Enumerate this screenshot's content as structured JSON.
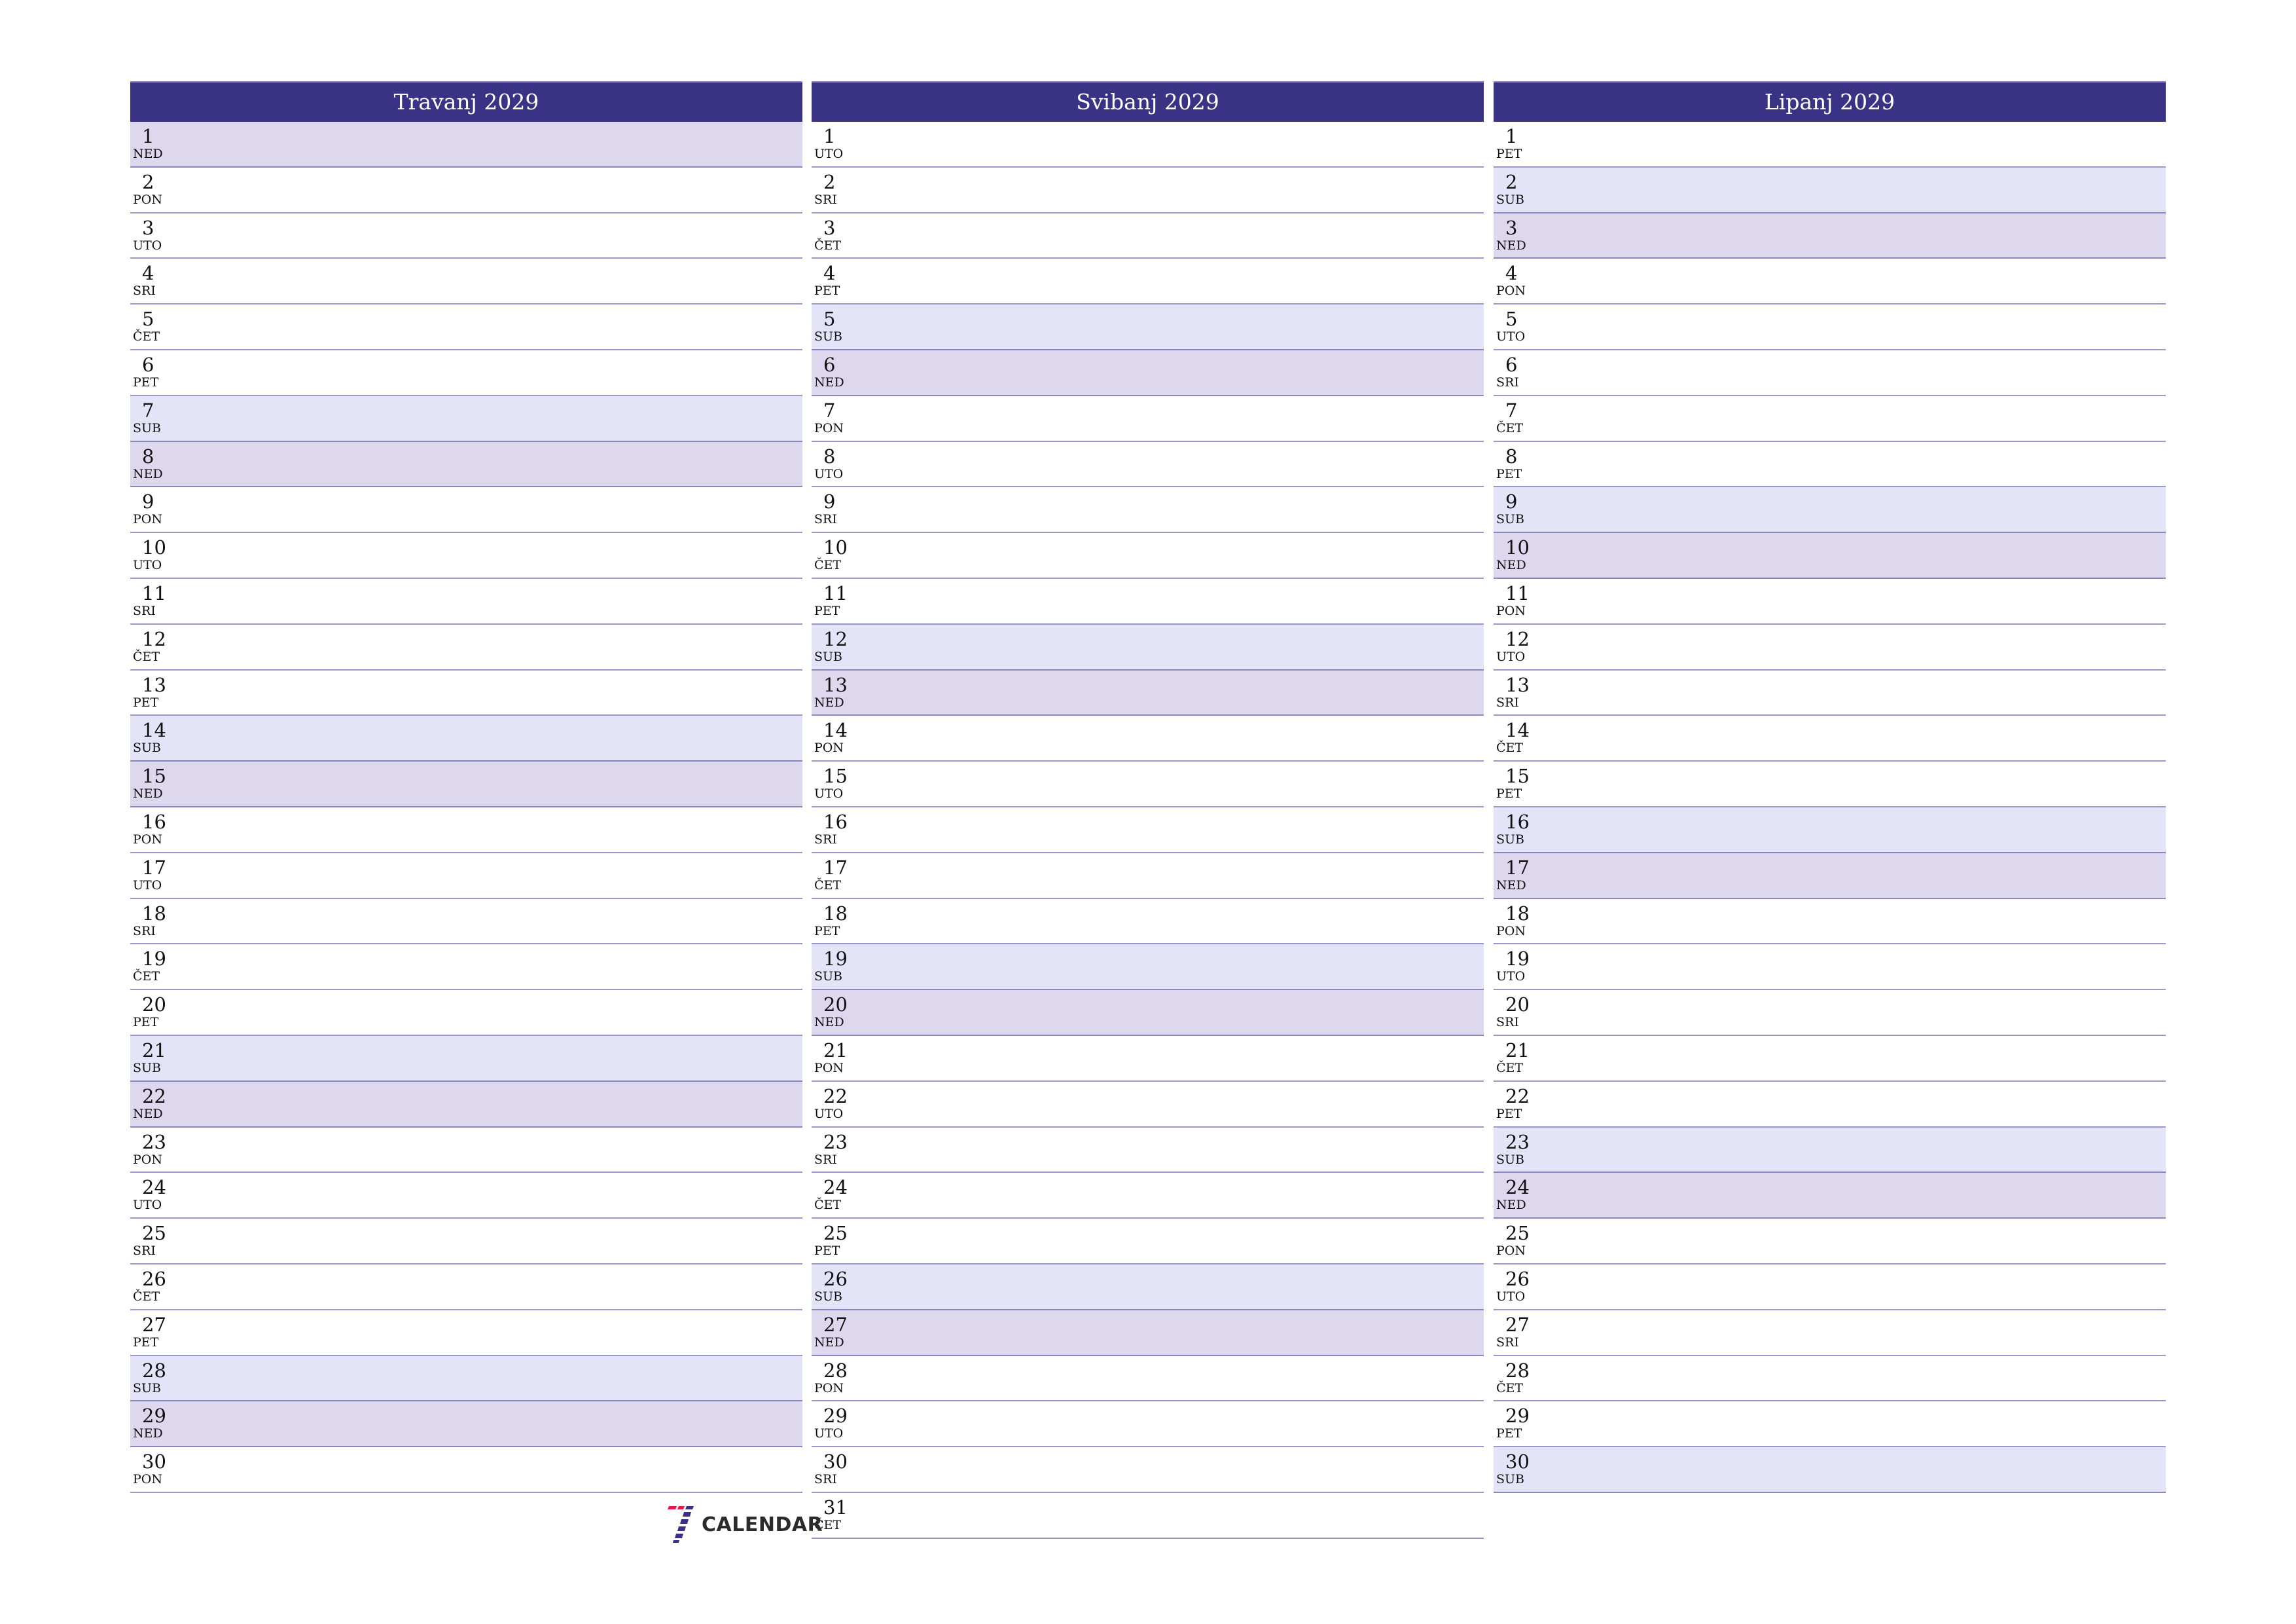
{
  "colors": {
    "header_bg": "#3A3284",
    "saturday_bg": "#E4E4F8",
    "sunday_bg": "#DDD8EE",
    "row_border": "#9C98C9",
    "logo_red": "#E8174A",
    "logo_purple": "#3A3088"
  },
  "months": [
    {
      "title": "Travanj 2029",
      "days": [
        {
          "num": "1",
          "name": "NED",
          "type": "sun"
        },
        {
          "num": "2",
          "name": "PON",
          "type": ""
        },
        {
          "num": "3",
          "name": "UTO",
          "type": ""
        },
        {
          "num": "4",
          "name": "SRI",
          "type": ""
        },
        {
          "num": "5",
          "name": "ČET",
          "type": ""
        },
        {
          "num": "6",
          "name": "PET",
          "type": ""
        },
        {
          "num": "7",
          "name": "SUB",
          "type": "sat"
        },
        {
          "num": "8",
          "name": "NED",
          "type": "sun"
        },
        {
          "num": "9",
          "name": "PON",
          "type": ""
        },
        {
          "num": "10",
          "name": "UTO",
          "type": ""
        },
        {
          "num": "11",
          "name": "SRI",
          "type": ""
        },
        {
          "num": "12",
          "name": "ČET",
          "type": ""
        },
        {
          "num": "13",
          "name": "PET",
          "type": ""
        },
        {
          "num": "14",
          "name": "SUB",
          "type": "sat"
        },
        {
          "num": "15",
          "name": "NED",
          "type": "sun"
        },
        {
          "num": "16",
          "name": "PON",
          "type": ""
        },
        {
          "num": "17",
          "name": "UTO",
          "type": ""
        },
        {
          "num": "18",
          "name": "SRI",
          "type": ""
        },
        {
          "num": "19",
          "name": "ČET",
          "type": ""
        },
        {
          "num": "20",
          "name": "PET",
          "type": ""
        },
        {
          "num": "21",
          "name": "SUB",
          "type": "sat"
        },
        {
          "num": "22",
          "name": "NED",
          "type": "sun"
        },
        {
          "num": "23",
          "name": "PON",
          "type": ""
        },
        {
          "num": "24",
          "name": "UTO",
          "type": ""
        },
        {
          "num": "25",
          "name": "SRI",
          "type": ""
        },
        {
          "num": "26",
          "name": "ČET",
          "type": ""
        },
        {
          "num": "27",
          "name": "PET",
          "type": ""
        },
        {
          "num": "28",
          "name": "SUB",
          "type": "sat"
        },
        {
          "num": "29",
          "name": "NED",
          "type": "sun"
        },
        {
          "num": "30",
          "name": "PON",
          "type": ""
        }
      ]
    },
    {
      "title": "Svibanj 2029",
      "days": [
        {
          "num": "1",
          "name": "UTO",
          "type": ""
        },
        {
          "num": "2",
          "name": "SRI",
          "type": ""
        },
        {
          "num": "3",
          "name": "ČET",
          "type": ""
        },
        {
          "num": "4",
          "name": "PET",
          "type": ""
        },
        {
          "num": "5",
          "name": "SUB",
          "type": "sat"
        },
        {
          "num": "6",
          "name": "NED",
          "type": "sun"
        },
        {
          "num": "7",
          "name": "PON",
          "type": ""
        },
        {
          "num": "8",
          "name": "UTO",
          "type": ""
        },
        {
          "num": "9",
          "name": "SRI",
          "type": ""
        },
        {
          "num": "10",
          "name": "ČET",
          "type": ""
        },
        {
          "num": "11",
          "name": "PET",
          "type": ""
        },
        {
          "num": "12",
          "name": "SUB",
          "type": "sat"
        },
        {
          "num": "13",
          "name": "NED",
          "type": "sun"
        },
        {
          "num": "14",
          "name": "PON",
          "type": ""
        },
        {
          "num": "15",
          "name": "UTO",
          "type": ""
        },
        {
          "num": "16",
          "name": "SRI",
          "type": ""
        },
        {
          "num": "17",
          "name": "ČET",
          "type": ""
        },
        {
          "num": "18",
          "name": "PET",
          "type": ""
        },
        {
          "num": "19",
          "name": "SUB",
          "type": "sat"
        },
        {
          "num": "20",
          "name": "NED",
          "type": "sun"
        },
        {
          "num": "21",
          "name": "PON",
          "type": ""
        },
        {
          "num": "22",
          "name": "UTO",
          "type": ""
        },
        {
          "num": "23",
          "name": "SRI",
          "type": ""
        },
        {
          "num": "24",
          "name": "ČET",
          "type": ""
        },
        {
          "num": "25",
          "name": "PET",
          "type": ""
        },
        {
          "num": "26",
          "name": "SUB",
          "type": "sat"
        },
        {
          "num": "27",
          "name": "NED",
          "type": "sun"
        },
        {
          "num": "28",
          "name": "PON",
          "type": ""
        },
        {
          "num": "29",
          "name": "UTO",
          "type": ""
        },
        {
          "num": "30",
          "name": "SRI",
          "type": ""
        },
        {
          "num": "31",
          "name": "ČET",
          "type": ""
        }
      ]
    },
    {
      "title": "Lipanj 2029",
      "days": [
        {
          "num": "1",
          "name": "PET",
          "type": ""
        },
        {
          "num": "2",
          "name": "SUB",
          "type": "sat"
        },
        {
          "num": "3",
          "name": "NED",
          "type": "sun"
        },
        {
          "num": "4",
          "name": "PON",
          "type": ""
        },
        {
          "num": "5",
          "name": "UTO",
          "type": ""
        },
        {
          "num": "6",
          "name": "SRI",
          "type": ""
        },
        {
          "num": "7",
          "name": "ČET",
          "type": ""
        },
        {
          "num": "8",
          "name": "PET",
          "type": ""
        },
        {
          "num": "9",
          "name": "SUB",
          "type": "sat"
        },
        {
          "num": "10",
          "name": "NED",
          "type": "sun"
        },
        {
          "num": "11",
          "name": "PON",
          "type": ""
        },
        {
          "num": "12",
          "name": "UTO",
          "type": ""
        },
        {
          "num": "13",
          "name": "SRI",
          "type": ""
        },
        {
          "num": "14",
          "name": "ČET",
          "type": ""
        },
        {
          "num": "15",
          "name": "PET",
          "type": ""
        },
        {
          "num": "16",
          "name": "SUB",
          "type": "sat"
        },
        {
          "num": "17",
          "name": "NED",
          "type": "sun"
        },
        {
          "num": "18",
          "name": "PON",
          "type": ""
        },
        {
          "num": "19",
          "name": "UTO",
          "type": ""
        },
        {
          "num": "20",
          "name": "SRI",
          "type": ""
        },
        {
          "num": "21",
          "name": "ČET",
          "type": ""
        },
        {
          "num": "22",
          "name": "PET",
          "type": ""
        },
        {
          "num": "23",
          "name": "SUB",
          "type": "sat"
        },
        {
          "num": "24",
          "name": "NED",
          "type": "sun"
        },
        {
          "num": "25",
          "name": "PON",
          "type": ""
        },
        {
          "num": "26",
          "name": "UTO",
          "type": ""
        },
        {
          "num": "27",
          "name": "SRI",
          "type": ""
        },
        {
          "num": "28",
          "name": "ČET",
          "type": ""
        },
        {
          "num": "29",
          "name": "PET",
          "type": ""
        },
        {
          "num": "30",
          "name": "SUB",
          "type": "sat"
        }
      ]
    }
  ],
  "logo": {
    "text": "CALENDAR",
    "icon": "seven-calendar-logo-icon"
  }
}
